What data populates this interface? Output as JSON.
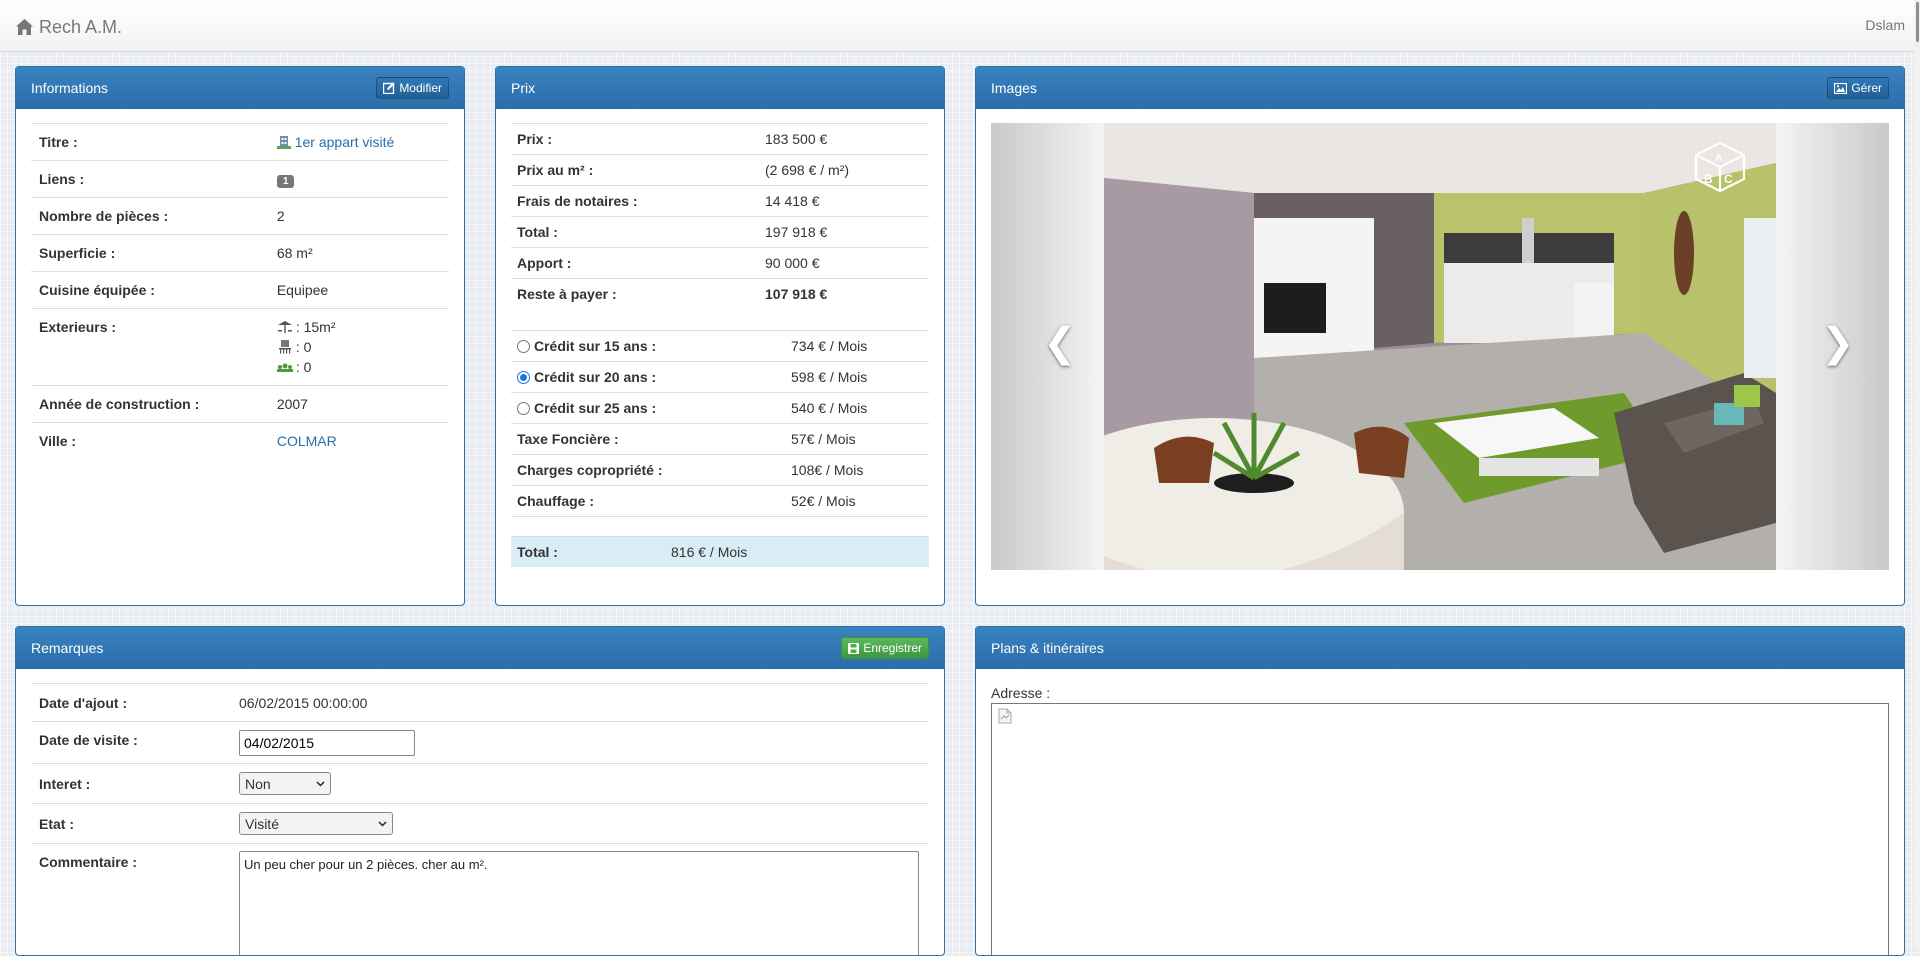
{
  "navbar": {
    "brand": "Rech A.M.",
    "user": "Dslam"
  },
  "colors": {
    "panel_header": "#2f73b0",
    "total_row_bg": "#d9edf7",
    "save_button": "#4cae4c"
  },
  "informations": {
    "title": "Informations",
    "edit_label": "Modifier",
    "rows": {
      "titre": {
        "label": "Titre :",
        "value": "1er appart visité"
      },
      "liens": {
        "label": "Liens :",
        "value": "1"
      },
      "pieces": {
        "label": "Nombre de pièces :",
        "value": "2"
      },
      "superficie": {
        "label": "Superficie :",
        "value": "68 m²"
      },
      "cuisine": {
        "label": "Cuisine équipée :",
        "value": "Equipee"
      },
      "exterieurs": {
        "label": "Exterieurs :",
        "terrasse": ": 15m²",
        "balcon": ": 0",
        "jardin": ": 0"
      },
      "annee": {
        "label": "Année de construction :",
        "value": "2007"
      },
      "ville": {
        "label": "Ville :",
        "value": "COLMAR"
      }
    }
  },
  "prix": {
    "title": "Prix",
    "rows": [
      {
        "label": "Prix :",
        "value": "183 500 €"
      },
      {
        "label": "Prix au m² :",
        "value": "(2 698 € / m²)"
      },
      {
        "label": "Frais de notaires :",
        "value": "14 418 €"
      },
      {
        "label": "Total :",
        "value": "197 918 €"
      },
      {
        "label": "Apport :",
        "value": "90 000 €"
      },
      {
        "label": "Reste à payer :",
        "value": "107 918 €"
      }
    ],
    "credits": [
      {
        "label": "Crédit sur 15 ans :",
        "value": "734 € / Mois",
        "selected": false
      },
      {
        "label": "Crédit sur 20 ans :",
        "value": "598 € / Mois",
        "selected": true
      },
      {
        "label": "Crédit sur 25 ans :",
        "value": "540 € / Mois",
        "selected": false
      }
    ],
    "charges": [
      {
        "label": "Taxe Foncière :",
        "value": "57€ / Mois"
      },
      {
        "label": "Charges copropriété :",
        "value": "108€ / Mois"
      },
      {
        "label": "Chauffage :",
        "value": "52€ / Mois"
      }
    ],
    "total": {
      "label": "Total :",
      "value": "816 € / Mois"
    }
  },
  "images": {
    "title": "Images",
    "manage_label": "Gérer",
    "prev_icon": "chevron-left-icon",
    "next_icon": "chevron-right-icon",
    "watermark_icon": "abc-cube-logo"
  },
  "remarques": {
    "title": "Remarques",
    "save_label": "Enregistrer",
    "date_ajout": {
      "label": "Date d'ajout :",
      "value": "06/02/2015 00:00:00"
    },
    "date_visite": {
      "label": "Date de visite :",
      "value": "04/02/2015"
    },
    "interet": {
      "label": "Interet :",
      "value": "Non"
    },
    "etat": {
      "label": "Etat :",
      "value": "Visité"
    },
    "commentaire": {
      "label": "Commentaire :",
      "value": "Un peu cher pour un 2 pièces. cher au m²."
    }
  },
  "plans": {
    "title": "Plans & itinéraires",
    "address_label": "Adresse :"
  }
}
